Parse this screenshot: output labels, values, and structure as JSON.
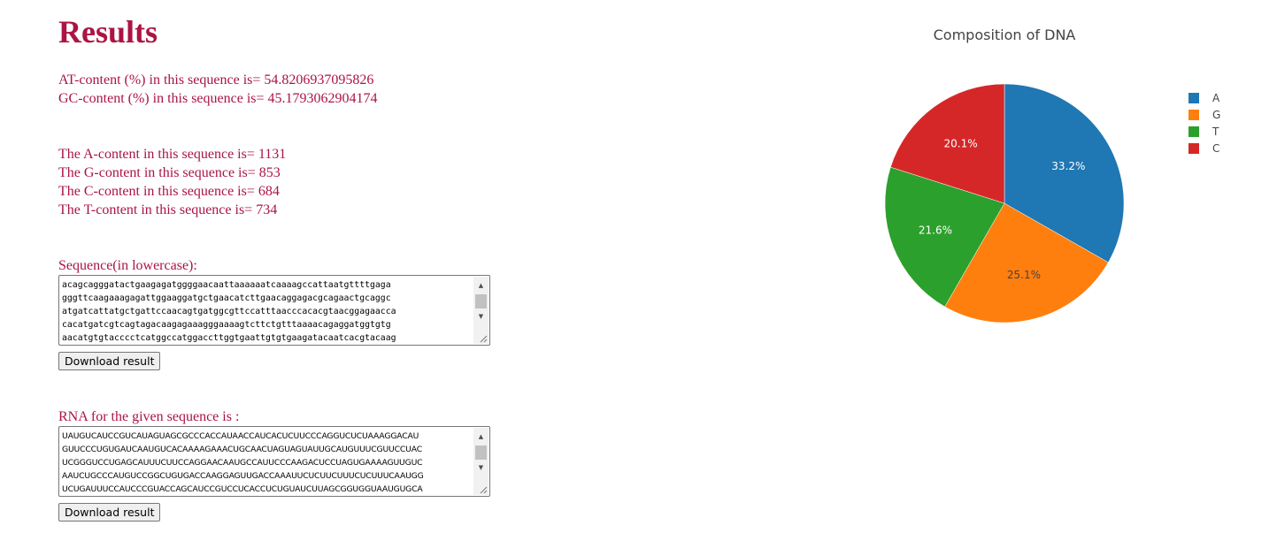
{
  "page": {
    "title": "Results"
  },
  "content": {
    "at_line": "AT-content (%) in this sequence is= 54.8206937095826",
    "gc_line": "GC-content (%) in this sequence is= 45.1793062904174",
    "counts": [
      "The A-content in this sequence is= 1131",
      "The G-content in this sequence is= 853",
      "The C-content in this sequence is= 684",
      "The T-content in this sequence is= 734"
    ]
  },
  "sequence": {
    "label": "Sequence(in lowercase):",
    "text": "acagcagggatactgaagagatggggaacaattaaaaaatcaaaagccattaatgttttgaga\ngggttcaagaaagagattggaaggatgctgaacatcttgaacaggagacgcagaactgcaggc\natgatcattatgctgattccaacagtgatggcgttccatttaacccacacgtaacggagaacca\ncacatgatcgtcagtagacaagagaaagggaaaagtcttctgtttaaaacagaggatggtgtg\naacatgtgtacccctcatggccatggaccttggtgaattgtgtgaagatacaatcacgtacaag",
    "download_label": "Download result"
  },
  "rna": {
    "label": "RNA for the given sequence is :",
    "text": "UAUGUCAUCCGUCAUAGUAGCGCCCACCAUAACCAUCACUCUUCCCAGGUCUCUAAAGGACAU\nGUUCCCUGUGAUCAAUGUCACAAAAGAAACUGCAACUAGUAGUAUUGCAUGUUUCGUUCCUAC\nUCGGGUCCUGAGCAUUUCUUCCAGGAACAAUGCCAUUCCCAAGACUCCUAGUGAAAAGUUGUC\nAAUCUGCCCAUGUCCGGCUGUGACCAAGGAGUUGACCAAAUUCUCUUCUUUCUCUUUCAAUGG\nUCUGAUUUCCAUCCCGUACCAGCAUCCGUCCUCACCUCUGUAUCUUAGCGGUGGUAAUGUGCA",
    "download_label": "Download result"
  },
  "scroll_icons": {
    "up": "scroll-up-arrow-icon",
    "down": "scroll-down-arrow-icon",
    "up_glyph": "▲",
    "down_glyph": "▼"
  },
  "chart_data": {
    "type": "pie",
    "title": "Composition of DNA",
    "labels": [
      "A",
      "G",
      "T",
      "C"
    ],
    "values": [
      1131,
      853,
      734,
      684
    ],
    "percent_labels": [
      "33.2%",
      "25.1%",
      "21.6%",
      "20.1%"
    ],
    "colors": [
      "#1f77b4",
      "#ff7f0e",
      "#2ca02c",
      "#d62728"
    ],
    "label_colors": [
      "#ffffff",
      "#444444",
      "#ffffff",
      "#ffffff"
    ],
    "legend_position": "top-right"
  }
}
